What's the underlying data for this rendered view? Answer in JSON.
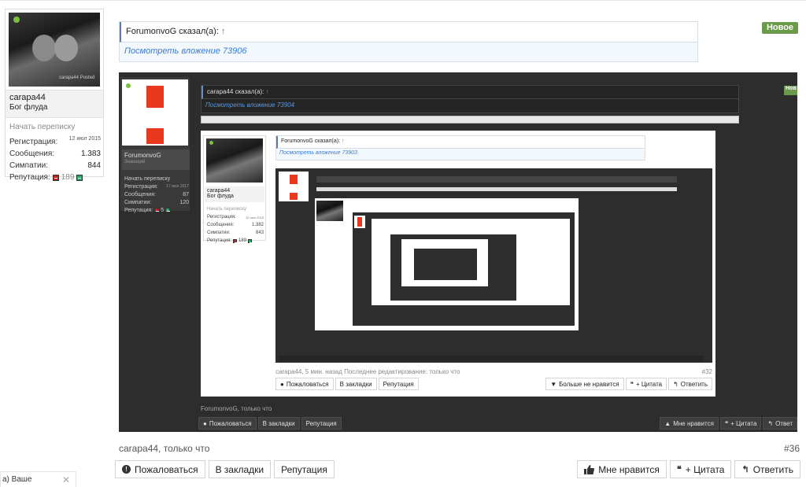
{
  "user": {
    "name": "carapa44",
    "title": "Бог флуда",
    "start_conversation": "Начать переписку",
    "registration_label": "Регистрация:",
    "registration_value": "12 июл 2015",
    "messages_label": "Сообщения:",
    "messages_value": "1.383",
    "likes_label": "Симпатии:",
    "likes_value": "844",
    "reputation_label": "Репутация:",
    "reputation_value": "189",
    "avatar_watermark": "carapa44 Posted"
  },
  "badge_new": "Новое",
  "quote": {
    "author_line": "ForumonvoG сказал(а):",
    "arrow": "↑",
    "attachment_link": "Посмотреть вложение 73906"
  },
  "embedded": {
    "user": {
      "name": "ForumonvoG",
      "title": "Знающий",
      "start_conversation": "Начать переписку",
      "registration_label": "Регистрация:",
      "registration_value": "17 июл 2017",
      "messages_label": "Сообщения:",
      "messages_value": "87",
      "likes_label": "Симпатии:",
      "likes_value": "120",
      "reputation_label": "Репутация:",
      "reputation_value": "5"
    },
    "badge_new": "Нов",
    "quote_author_line": "carapa44 сказал(а):",
    "quote_arrow": "↑",
    "quote_attachment": "Посмотреть вложение 73904",
    "inner": {
      "user": {
        "name": "carapa44",
        "title": "Бог флуда",
        "start_conversation": "Начать переписку",
        "registration_label": "Регистрация:",
        "registration_value": "12 июл 2015",
        "messages_label": "Сообщения:",
        "messages_value": "1.382",
        "likes_label": "Симпатии:",
        "likes_value": "843",
        "reputation_label": "Репутация:",
        "reputation_value": "189"
      },
      "quote_author_line": "ForumonvoG сказал(а):",
      "quote_arrow": "↑",
      "quote_attachment": "Посмотреть вложение 73903",
      "meta": "carapa44, 5 мин. назад Последнее редактирование: только что",
      "post_number": "#32",
      "buttons_left": [
        "Пожаловаться",
        "В закладки",
        "Репутация"
      ],
      "buttons_right": [
        "Больше не нравится",
        "+ Цитата",
        "Ответить"
      ]
    },
    "footer": "ForumonvoG, только что",
    "buttons_left": [
      "Пожаловаться",
      "В закладки",
      "Репутация"
    ],
    "buttons_right": [
      "Мне нравится",
      "+ Цитата",
      "Ответ"
    ]
  },
  "meta": "carapa44, только что",
  "post_number": "#36",
  "buttons": {
    "report": "Пожаловаться",
    "bookmark": "В закладки",
    "reputation": "Репутация",
    "like": "Мне нравится",
    "quote": "+ Цитата",
    "reply": "Ответить"
  },
  "notification": {
    "text": "а) Ваше"
  },
  "icons": {
    "report": "alert-circle-icon",
    "like": "thumbs-up-icon",
    "dislike": "thumbs-down-icon",
    "quote": "quote-icon",
    "reply": "reply-arrow-icon",
    "close": "close-icon"
  },
  "colors": {
    "badge_new": "#6a9a4a",
    "link": "#3a7bd5",
    "online": "#7ac142",
    "rep_negative": "#b22222",
    "rep_positive": "#22aa66",
    "embedded_bg": "#2d2d2d",
    "logo_red": "#e8391e"
  }
}
